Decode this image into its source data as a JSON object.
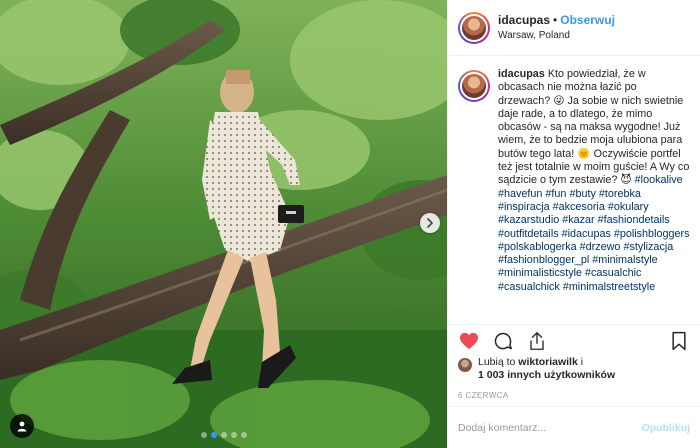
{
  "header": {
    "username": "idacupas",
    "separator": "•",
    "follow_label": "Obserwuj",
    "location": "Warsaw, Poland"
  },
  "caption": {
    "username": "idacupas",
    "text": "Kto powiedział, że w obcasach nie można łazić po drzewach? 😜 Ja sobie w nich swietnie daje rade, a to dlatego, że mimo obcasów - są na maksa wygodne! Już wiem, że to bedzie moja ulubiona para butów tego lata! 🌞 Oczywiście portfel też jest totalnie w moim guście! A Wy co sądzicie o tym zestawie? 😈",
    "hashtags": "#lookalive #havefun #fun #buty #torebka #inspiracja #akcesoria #okulary #kazarstudio #kazar #fashiondetails #outfitdetails #idacupas #polishbloggers #polskablogerka #drzewo #stylizacja #fashionblogger_pl #minimalstyle #minimalisticstyle #casualchic #casualchick #minimalstreetstyle"
  },
  "likes": {
    "line1_prefix": "Lubią to",
    "line1_user": "wiktoriawilk",
    "line1_suffix": "i",
    "line2": "1 003 innych użytkowników"
  },
  "date": "6 CZERWCA",
  "comment_box": {
    "placeholder": "Dodaj komentarz...",
    "publish_label": "Opublikuj"
  },
  "carousel": {
    "total": 5,
    "active_index": 1
  },
  "colors": {
    "accent": "#3897f0",
    "like_heart": "#ed4956",
    "hashtag": "#003569",
    "publish_disabled": "#b2dffc"
  },
  "icons": [
    "heart-icon",
    "comment-icon",
    "share-icon",
    "bookmark-icon",
    "chevron-right-icon",
    "user-tag-icon"
  ]
}
